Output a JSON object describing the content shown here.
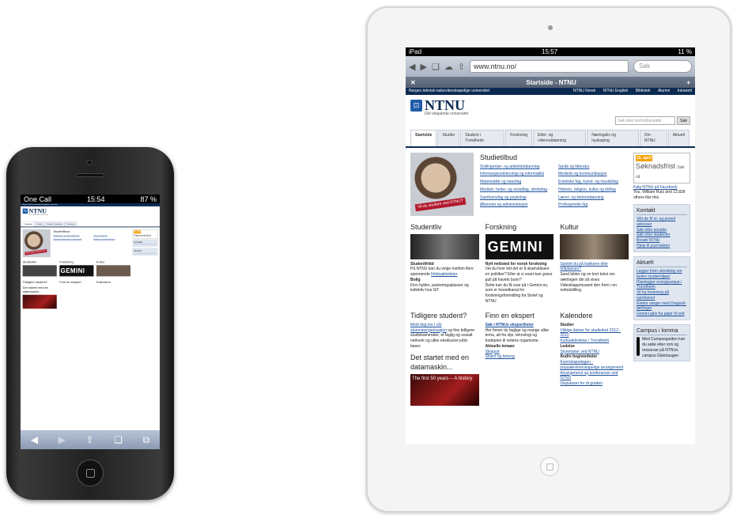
{
  "phone": {
    "carrier": "One Call",
    "time": "15:54",
    "battery": "87 %"
  },
  "tablet": {
    "device": "iPad",
    "time": "15:57",
    "battery": "11 %",
    "url": "www.ntnu.no/",
    "search_placeholder": "Søk",
    "page_title": "Startside - NTNU"
  },
  "site": {
    "topbar_left": "Norges teknisk-naturvitenskapelige universitet",
    "topbar_links": [
      "NTNU Norsk",
      "NTNU English",
      "Bibliotek",
      "Alumni",
      "Intranett"
    ],
    "logo": "NTNU",
    "tagline": "Det skapende universitet",
    "search_placeholder": "Søk etter innhold/ansatte",
    "search_button": "Søk",
    "nav": [
      "Startside",
      "Studier",
      "Student i Trondheim",
      "Forskning",
      "Etter- og videreutdanning",
      "Næringsliv og nyskaping",
      "Om NTNU",
      "Aktuelt"
    ],
    "studietilbud": {
      "title": "Studietilbud",
      "badge": "Vil du studere ved NTNU?",
      "links": [
        "Sivilingeniør- og arkitektutdanning",
        "Språk og litteratur",
        "Informasjonsteknologi og informatikk",
        "Medieliv og kommunikasjon",
        "Matematikk og naturfag",
        "Estetiske fag, kunst- og musikkfag",
        "Medisin, helse- og sosialfag, idrettsfag",
        "Historie, religion, kultur og idéfag",
        "Samfunnsfag og psykologi",
        "Lærer- og lektorutdanning",
        "Økonomi og administrasjon",
        "Profesjonelle fag"
      ]
    },
    "studentliv": {
      "title": "Studentliv",
      "h": "Studentfritid",
      "text": "På NTNU kan du velge mellom flere spennende",
      "link": "fritidsaktiviteter",
      "h2": "Bolig",
      "text2": "Finn hybler, parkeringsplasser og kollektiv hos SiT"
    },
    "forskning": {
      "title": "Forskning",
      "banner": "GEMINI",
      "h": "Nytt nettsted for norsk forskning",
      "text": "Vet du hvor lett det er å skamslåsere en politiker? Eller at vi snart kan grave gull på havets bunn?",
      "text2": "Dette kan du få svar på i Gemini.no, som er hovedkanal for forskningsformidling fra Sintef og NTNU"
    },
    "kultur": {
      "title": "Kultur",
      "link": "Sanitet du på bakkene eller teltplassen?",
      "text": "Sand bilder og en kort tekst om værtingen din så vises Videoklappmuseet den frem i en nettutstilling."
    },
    "tidligere": {
      "title": "Tidligere student?",
      "link": "Meld deg inn i vår alumninorganisasjon",
      "text": "og finn tidligere studiekamerater, et faglig og sosialt nettverk og ulike eksklusive jobb-baser."
    },
    "ekspert": {
      "title": "Finn en ekspert",
      "h": "Søk i NTNUs ekspertlister",
      "text": "Her finner du faglige og mange ulike tema, alt fra olje, teknologi og hodepine til rettens organisme.",
      "h2": "Aktuelle temaer",
      "links": [
        "Skispurt",
        "Strøm og betong"
      ]
    },
    "kalendere": {
      "title": "Kalendere",
      "h": "Studier",
      "links": [
        "Viktige datoer for studieåret 2012 - 2013",
        "Kulturaktiviteter i Trondheim"
      ],
      "h2": "Ledelse",
      "link2": "Styremøter ved NTNU",
      "h3": "Andre begivenheter",
      "links3": [
        "Kunnskapsdagen - populærvitenskapelige arrangement",
        "Arrangement og konferanser ved NTNU",
        "Disputaser for dr.graden"
      ]
    },
    "datamaskin": {
      "title": "Det startet med en datamaskin...",
      "video": "The first 50 years -- A history"
    },
    "sidebar": {
      "frist_date": "15. april",
      "frist_label": "Søknadsfrist",
      "frist_more": "Søk nå",
      "facebook": "Følg NTNU på Facebook",
      "fb_text": "You, William Ruts and 13,828 others like this.",
      "kontakt_title": "Kontakt",
      "kontakt": [
        "Vikt de fil nr. og posed adresser",
        "Søk etter ansatte",
        "Søk etter studenter",
        "Besøk NTNU",
        "Hjelp til journalister"
      ],
      "aktuelt_title": "Aktuelt",
      "aktuelt": [
        "Legger frem utredning om bedre studiemiljøer",
        "Planlegger energiparque i Trondheim",
        "Vil ha forskning på samfunnet",
        "Rektor sørger med Dragvoll-lærlinger",
        "Gemini gikk fra papir til nett"
      ],
      "campus_title": "Campus i lomma",
      "campus_text": "Med Campusguiden kan du søke etter rom og ressurser på NTNUs campus Gløshaugen"
    }
  }
}
